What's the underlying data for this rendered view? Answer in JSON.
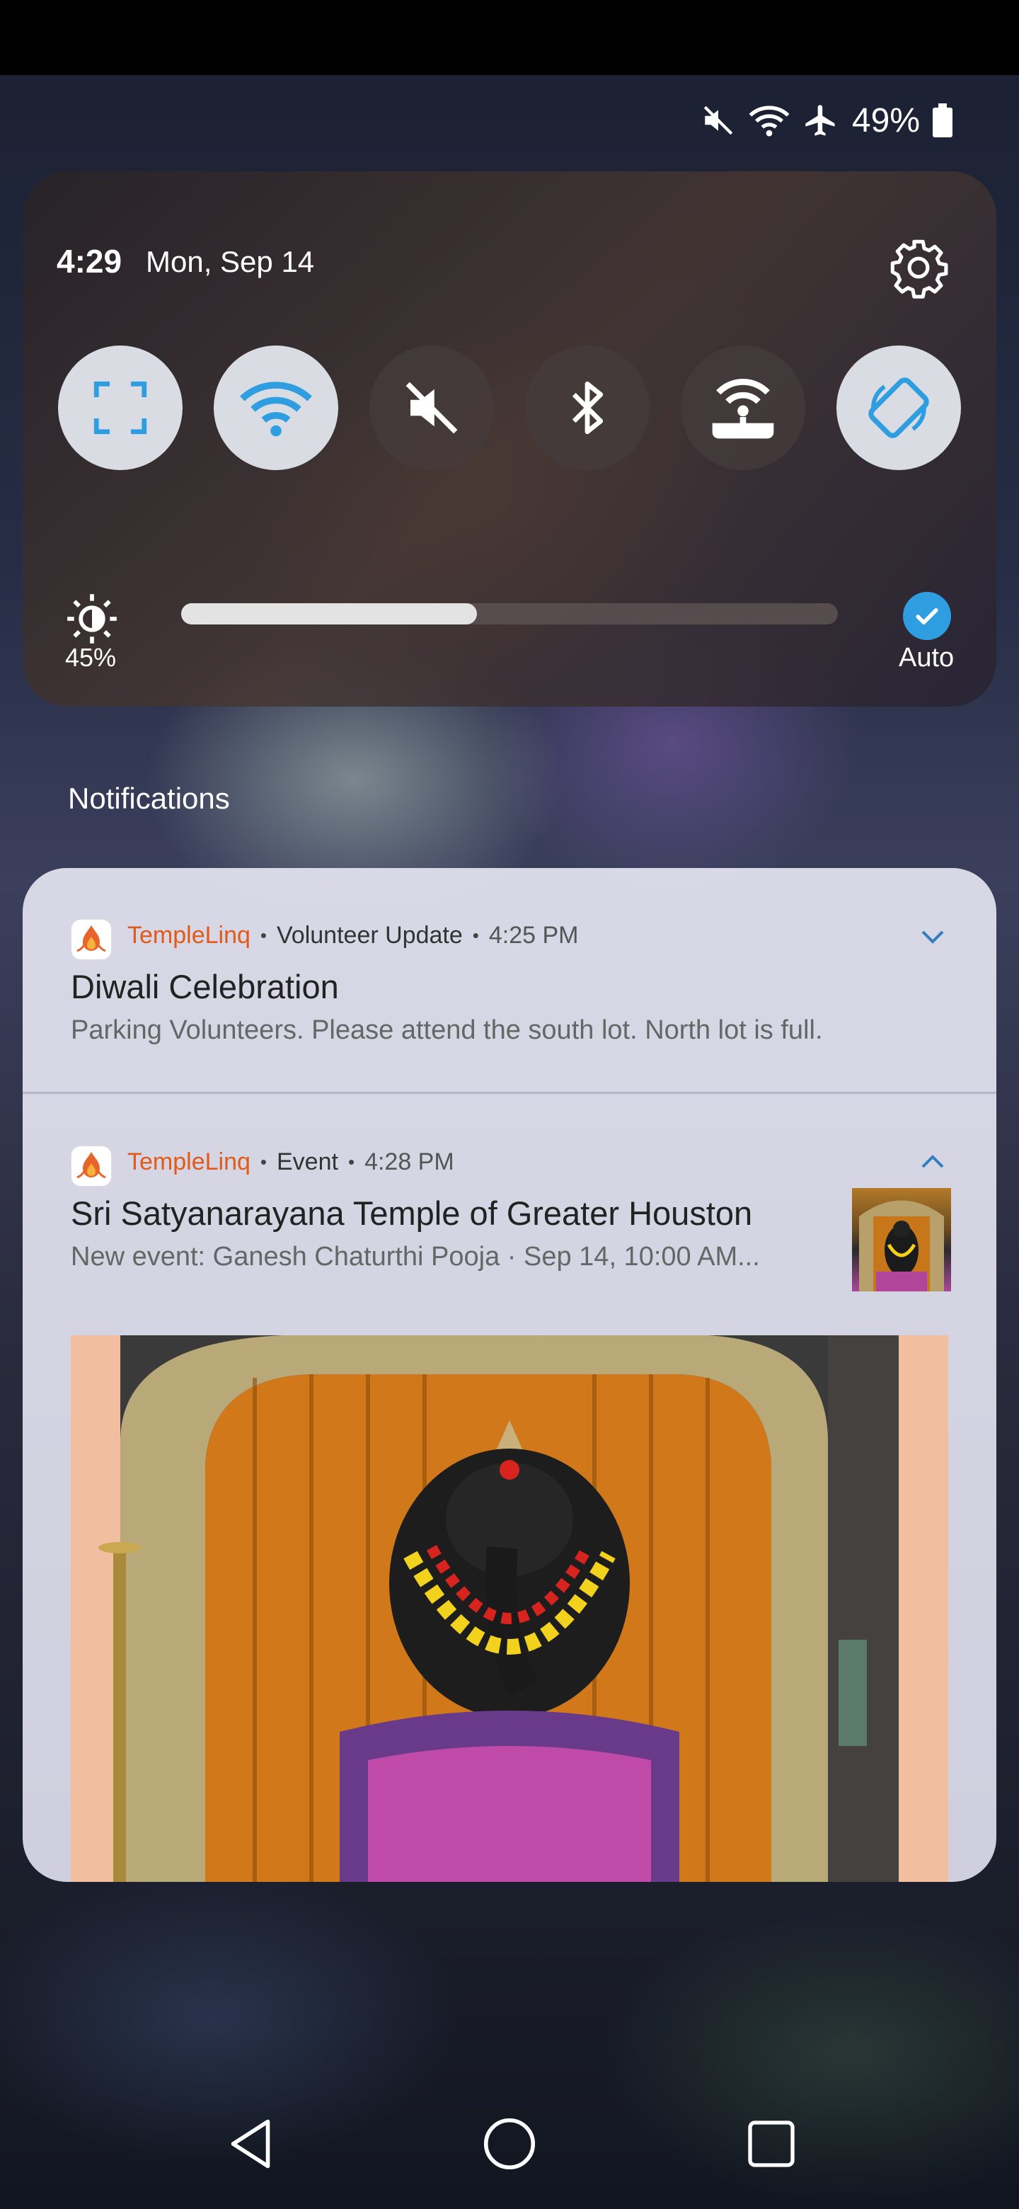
{
  "status_bar": {
    "battery_percent": "49%",
    "icons": [
      "mute-icon",
      "wifi-icon",
      "airplane-icon",
      "battery-icon"
    ]
  },
  "quick_settings": {
    "time": "4:29",
    "date": "Mon, Sep 14",
    "tiles": [
      {
        "name": "screen-capture",
        "icon": "screen-capture-icon",
        "state": "on"
      },
      {
        "name": "wifi",
        "icon": "wifi-icon",
        "state": "on"
      },
      {
        "name": "sound",
        "icon": "mute-icon",
        "state": "off"
      },
      {
        "name": "bluetooth",
        "icon": "bluetooth-icon",
        "state": "off"
      },
      {
        "name": "hotspot",
        "icon": "hotspot-icon",
        "state": "off"
      },
      {
        "name": "auto-rotate",
        "icon": "rotate-icon",
        "state": "on"
      }
    ],
    "brightness": {
      "label": "45%",
      "level": 0.45
    },
    "auto_label": "Auto"
  },
  "notifications": {
    "heading": "Notifications",
    "items": [
      {
        "app": "TempleLinq",
        "channel": "Volunteer Update",
        "time": "4:25 PM",
        "title": "Diwali Celebration",
        "body": "Parking Volunteers. Please attend the south lot. North lot is full.",
        "expanded": false
      },
      {
        "app": "TempleLinq",
        "channel": "Event",
        "time": "4:28 PM",
        "title": "Sri Satyanarayana Temple of Greater Houston",
        "body": "New event: Ganesh Chaturthi Pooja · Sep 14, 10:00 AM...",
        "expanded": true
      }
    ]
  },
  "colors": {
    "accent": "#2f9ee0",
    "app_name": "#e05a1a",
    "tile_on": "#d9dde3"
  },
  "nav": {
    "buttons": [
      "back-icon",
      "home-icon",
      "recents-icon"
    ]
  }
}
